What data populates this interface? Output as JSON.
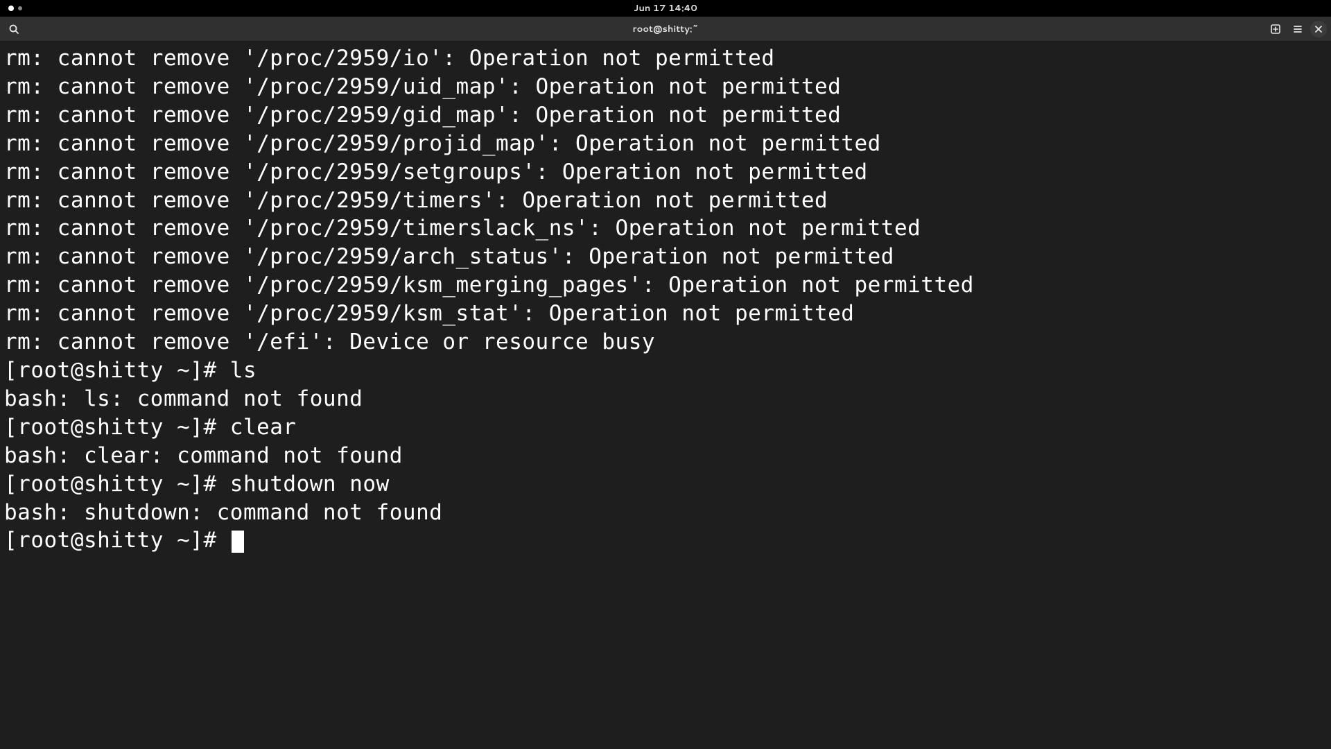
{
  "topbar": {
    "datetime": "Jun 17  14:40"
  },
  "headerbar": {
    "title": "root@shitty:~"
  },
  "terminal": {
    "lines": [
      "rm: cannot remove '/proc/2959/io': Operation not permitted",
      "rm: cannot remove '/proc/2959/uid_map': Operation not permitted",
      "rm: cannot remove '/proc/2959/gid_map': Operation not permitted",
      "rm: cannot remove '/proc/2959/projid_map': Operation not permitted",
      "rm: cannot remove '/proc/2959/setgroups': Operation not permitted",
      "rm: cannot remove '/proc/2959/timers': Operation not permitted",
      "rm: cannot remove '/proc/2959/timerslack_ns': Operation not permitted",
      "rm: cannot remove '/proc/2959/arch_status': Operation not permitted",
      "rm: cannot remove '/proc/2959/ksm_merging_pages': Operation not permitted",
      "rm: cannot remove '/proc/2959/ksm_stat': Operation not permitted",
      "rm: cannot remove '/efi': Device or resource busy",
      "[root@shitty ~]# ls",
      "bash: ls: command not found",
      "[root@shitty ~]# clear",
      "bash: clear: command not found",
      "[root@shitty ~]# shutdown now",
      "bash: shutdown: command not found"
    ],
    "prompt": "[root@shitty ~]# "
  }
}
